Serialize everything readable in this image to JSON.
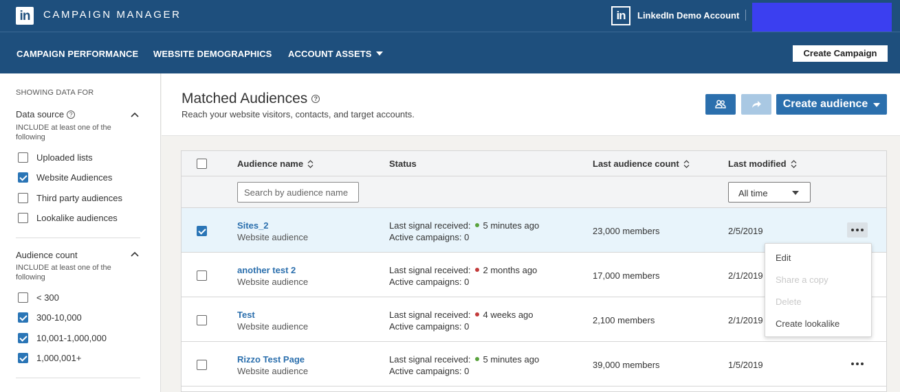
{
  "header": {
    "logo_text": "in",
    "app_title": "CAMPAIGN MANAGER",
    "account_logo_text": "in",
    "account_name": "LinkedIn Demo Account",
    "nav": [
      {
        "label": "CAMPAIGN PERFORMANCE"
      },
      {
        "label": "WEBSITE DEMOGRAPHICS"
      },
      {
        "label": "ACCOUNT ASSETS"
      }
    ],
    "create_campaign_label": "Create Campaign"
  },
  "sidebar": {
    "heading": "SHOWING DATA FOR",
    "data_source": {
      "title": "Data source",
      "help_glyph": "?",
      "subtitle": "INCLUDE at least one of the following",
      "options": [
        {
          "label": "Uploaded lists",
          "checked": false
        },
        {
          "label": "Website Audiences",
          "checked": true
        },
        {
          "label": "Third party audiences",
          "checked": false
        },
        {
          "label": "Lookalike audiences",
          "checked": false
        }
      ]
    },
    "audience_count": {
      "title": "Audience count",
      "subtitle": "INCLUDE at least one of the following",
      "options": [
        {
          "label": "< 300",
          "checked": false
        },
        {
          "label": "300-10,000",
          "checked": true
        },
        {
          "label": "10,001-1,000,000",
          "checked": true
        },
        {
          "label": "1,000,001+",
          "checked": true
        }
      ]
    }
  },
  "main": {
    "title": "Matched Audiences",
    "help_glyph": "?",
    "subtitle": "Reach your website visitors, contacts, and target accounts.",
    "create_audience_label": "Create audience",
    "icons": {
      "people": "people-icon",
      "share": "share-icon"
    },
    "colors": {
      "primary": "#2b6fad",
      "green_status": "#5aa33d",
      "red_status": "#c33b3b"
    }
  },
  "table": {
    "columns": {
      "name": "Audience name",
      "status": "Status",
      "count": "Last audience count",
      "modified": "Last modified"
    },
    "search_placeholder": "Search by audience name",
    "time_filter": "All time",
    "rows": [
      {
        "name": "Sites_2",
        "type": "Website audience",
        "signal_label": "Last signal received:",
        "signal_time": "5 minutes ago",
        "signal_color": "green",
        "campaigns": "Active campaigns: 0",
        "count": "23,000 members",
        "modified": "2/5/2019",
        "checked": true
      },
      {
        "name": "another test 2",
        "type": "Website audience",
        "signal_label": "Last signal received:",
        "signal_time": "2 months ago",
        "signal_color": "red",
        "campaigns": "Active campaigns: 0",
        "count": "17,000 members",
        "modified": "2/1/2019",
        "checked": false
      },
      {
        "name": "Test",
        "type": "Website audience",
        "signal_label": "Last signal received:",
        "signal_time": "4 weeks ago",
        "signal_color": "red",
        "campaigns": "Active campaigns: 0",
        "count": "2,100 members",
        "modified": "2/1/2019",
        "checked": false
      },
      {
        "name": "Rizzo Test Page",
        "type": "Website audience",
        "signal_label": "Last signal received:",
        "signal_time": "5 minutes ago",
        "signal_color": "green",
        "campaigns": "Active campaigns: 0",
        "count": "39,000 members",
        "modified": "1/5/2019",
        "checked": false
      }
    ]
  },
  "row_menu": {
    "items": [
      {
        "label": "Edit",
        "enabled": true
      },
      {
        "label": "Share a copy",
        "enabled": false
      },
      {
        "label": "Delete",
        "enabled": false
      },
      {
        "label": "Create lookalike",
        "enabled": true
      }
    ]
  }
}
